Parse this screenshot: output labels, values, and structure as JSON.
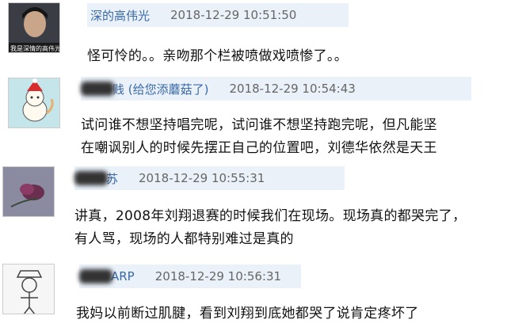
{
  "comments": [
    {
      "username": "深的高伟光",
      "timestamp": "2018-12-29 10:51:50",
      "avatar_caption": "我是深情的高伟光",
      "lines": [
        "怪可怜的。。亲吻那个栏被喷做戏喷惨了。。"
      ]
    },
    {
      "username": "贱 (给您添蘑菇了)",
      "timestamp": "2018-12-29 10:54:43",
      "lines": [
        "试问谁不想坚持唱完呢，试问谁不想坚持跑完呢，但凡能坚",
        "在嘲讽别人的时候先摆正自己的位置吧，刘德华依然是天王"
      ]
    },
    {
      "username": "苏",
      "timestamp": "2018-12-29 10:55:31",
      "lines": [
        "讲真，2008年刘翔退赛的时候我们在现场。现场真的都哭完了，",
        "有人骂，现场的人都特别难过是真的"
      ]
    },
    {
      "username": "ARP",
      "timestamp": "2018-12-29 10:56:31",
      "lines": [
        "我妈以前断过肌腱，看到刘翔到底她都哭了说肯定疼坏了"
      ]
    }
  ]
}
